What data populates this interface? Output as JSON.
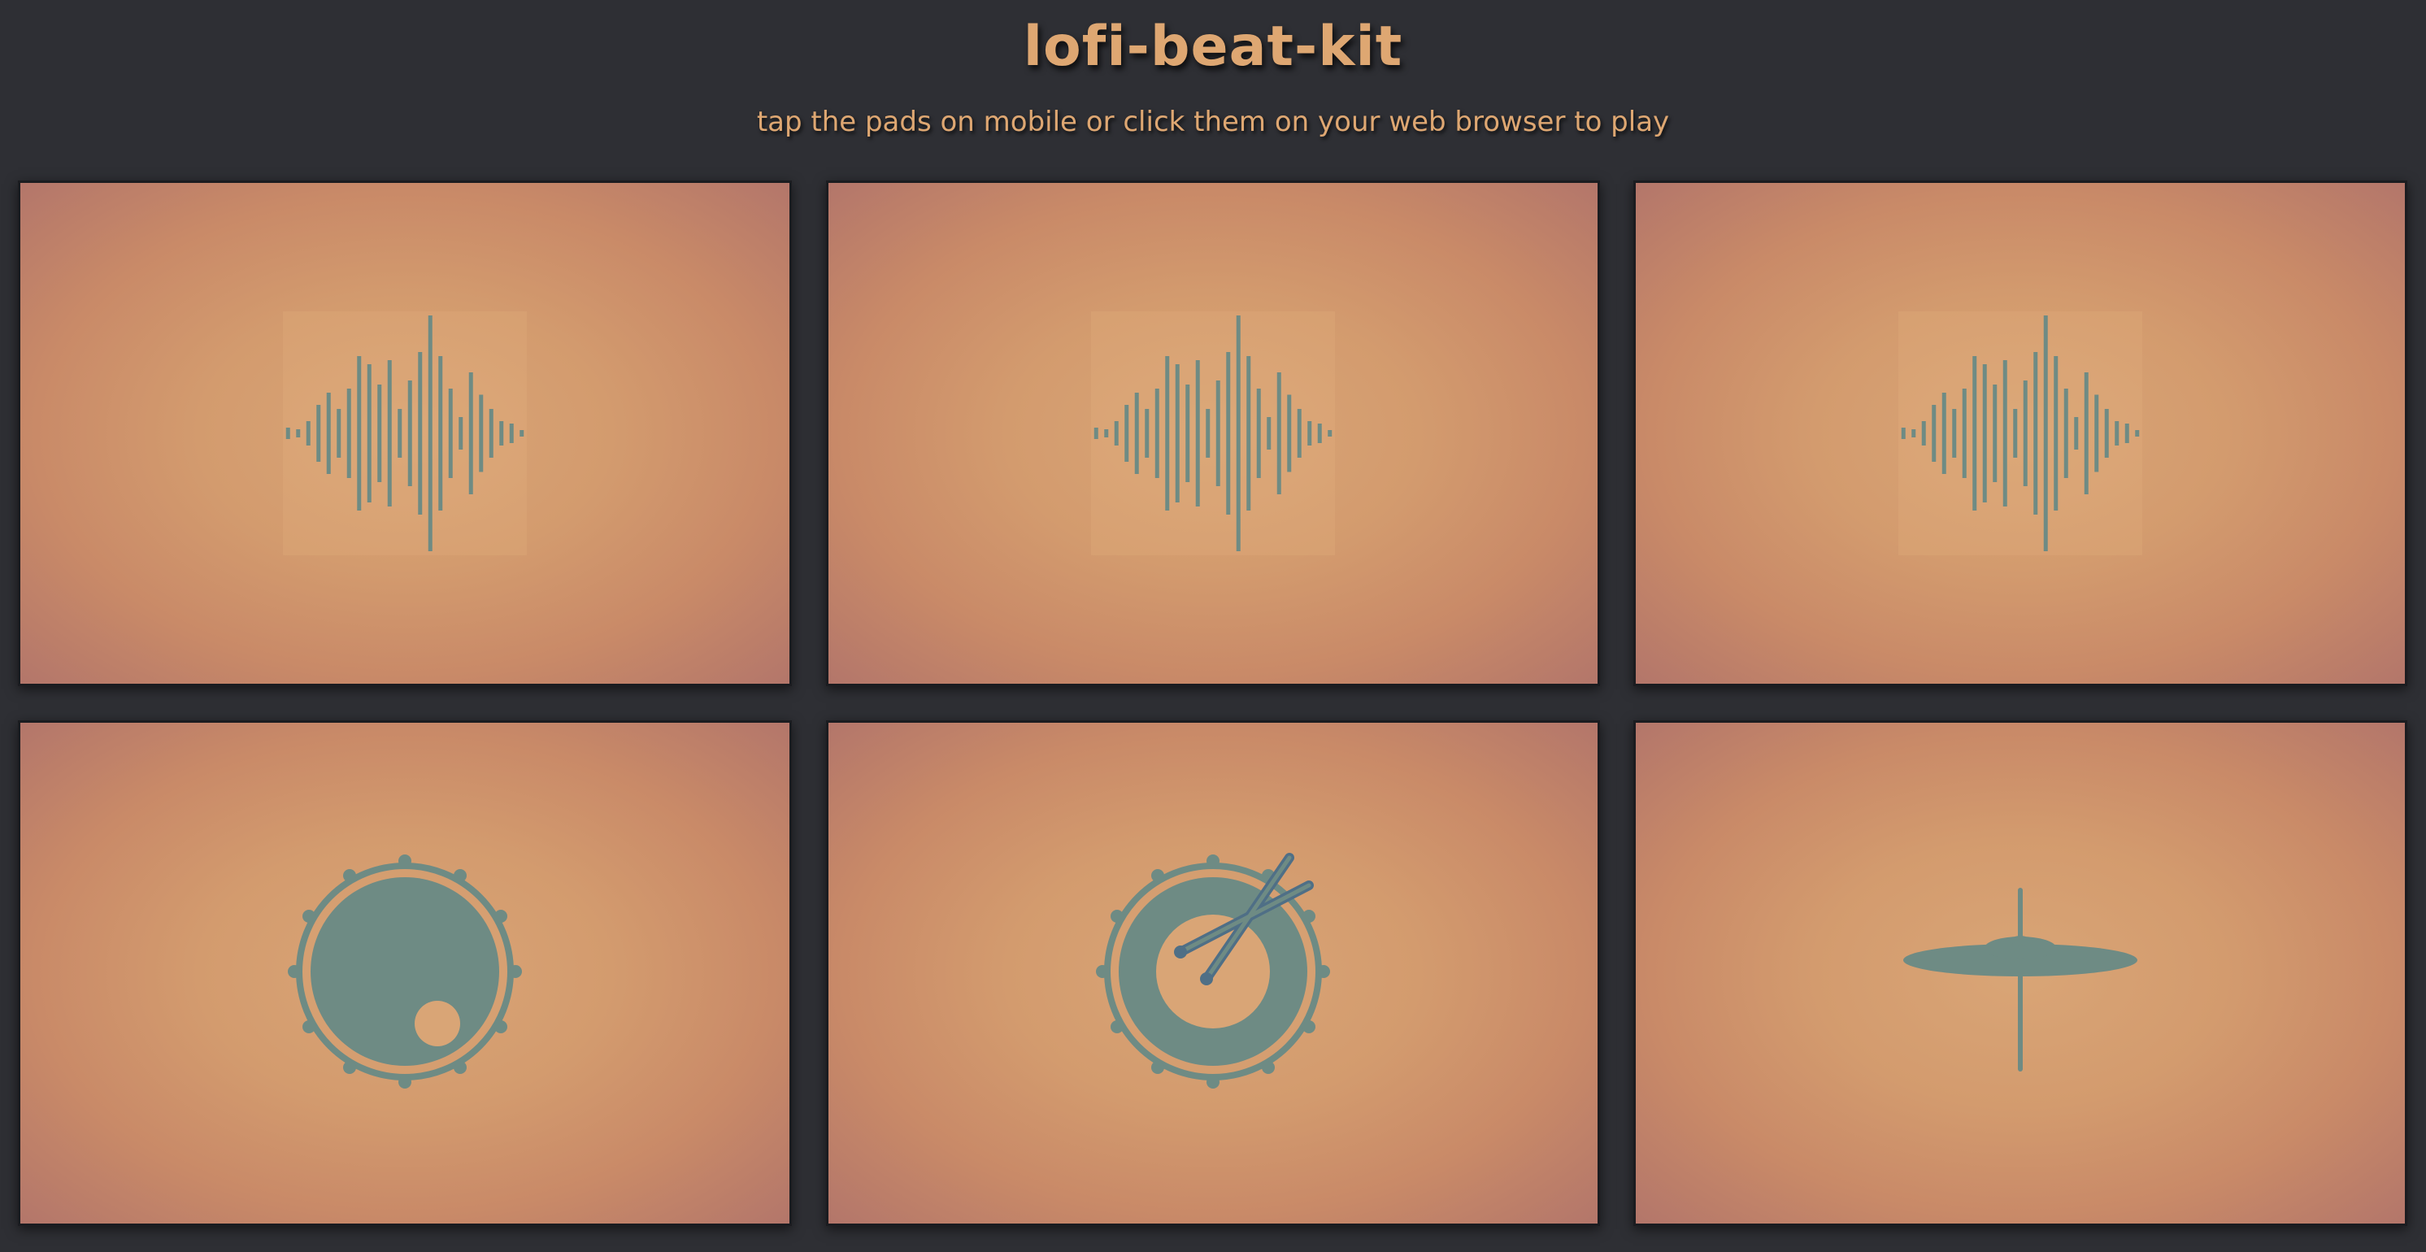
{
  "header": {
    "title": "lofi-beat-kit",
    "subtitle": "tap the pads on mobile or click them on your web browser to play"
  },
  "colors": {
    "background": "#2e2f34",
    "title": "#dea772",
    "pad_center": "#d9a576",
    "pad_edge": "#b3766a",
    "icon": "#6e8b84",
    "sticks": "#4f6f86"
  },
  "pads": [
    {
      "icon": "soundwave-icon"
    },
    {
      "icon": "soundwave-icon"
    },
    {
      "icon": "soundwave-icon"
    },
    {
      "icon": "kick-drum-icon"
    },
    {
      "icon": "snare-drum-with-sticks-icon"
    },
    {
      "icon": "cymbal-icon"
    }
  ]
}
